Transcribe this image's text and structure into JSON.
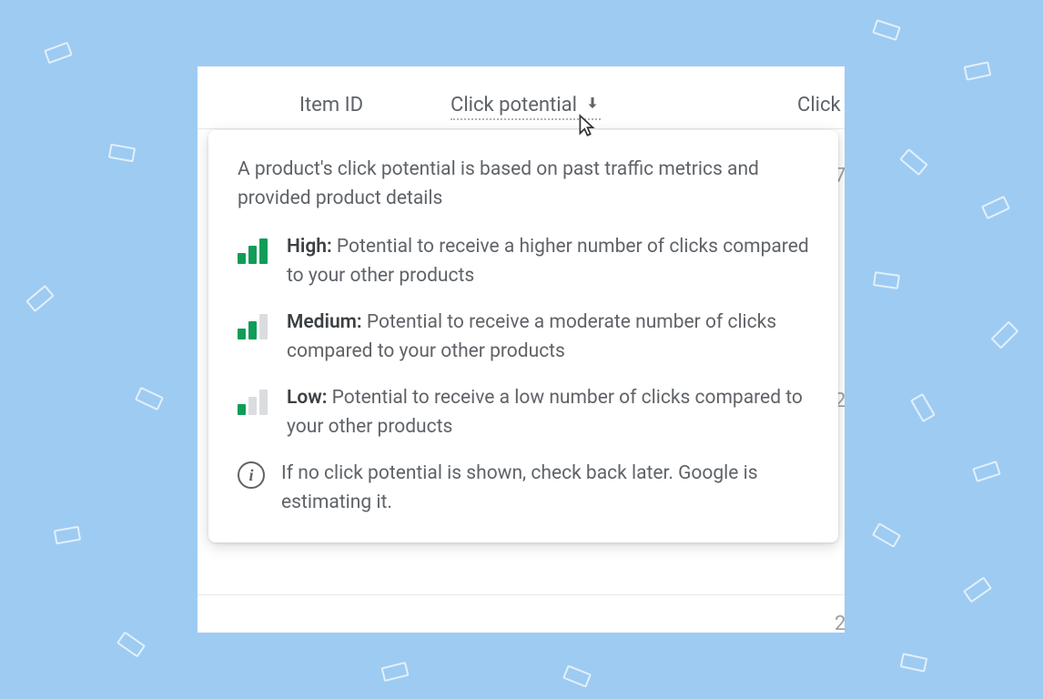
{
  "table": {
    "columns": {
      "item_id": "Item ID",
      "click_potential": "Click potential",
      "clicks_partial": "Click"
    }
  },
  "tooltip": {
    "intro": "A product's click potential is based on past traffic metrics and provided product details",
    "levels": {
      "high": {
        "label": "High:",
        "desc": " Potential to receive a higher number of clicks compared to your other products"
      },
      "medium": {
        "label": "Medium:",
        "desc": " Potential to receive a moderate number of clicks compared to your other products"
      },
      "low": {
        "label": "Low:",
        "desc": " Potential to receive a low number of clicks compared to your other products"
      }
    },
    "info_note": "If no click potential is shown, check back later. Google is estimating it."
  },
  "ghost_values": {
    "v1": "7",
    "v2": "2",
    "v3": "2"
  },
  "colors": {
    "green": "#0f9d58",
    "grey": "#dadce0",
    "bg": "#9ecbf2"
  }
}
